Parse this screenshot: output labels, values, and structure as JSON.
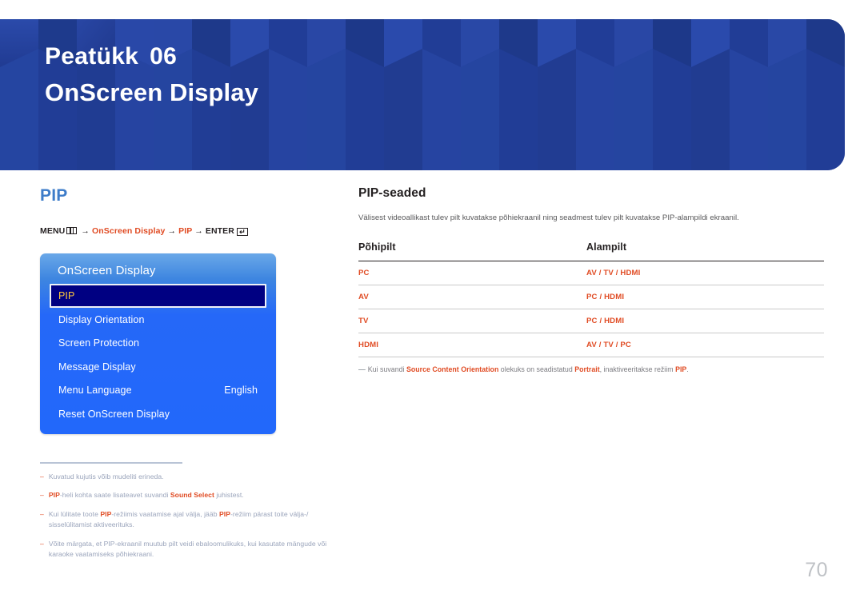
{
  "banner": {
    "chapter_label": "Peatükk",
    "chapter_number": "06",
    "chapter_title": "OnScreen Display",
    "bg_color": "#23409a"
  },
  "left": {
    "section_title": "PIP",
    "accent_color": "#e04b23",
    "menu_path": {
      "menu_label": "MENU",
      "menu_icon": "menu-grid-icon",
      "arrow1": "→",
      "step1": "OnScreen Display",
      "arrow2": "→",
      "step2": "PIP",
      "arrow3": "→",
      "enter_label": "ENTER",
      "enter_icon": "enter-key-icon",
      "enter_glyph": "↵"
    },
    "osd_panel": {
      "header": "OnScreen Display",
      "rows": [
        {
          "label": "PIP",
          "value": "",
          "selected": true
        },
        {
          "label": "Display Orientation",
          "value": "",
          "selected": false
        },
        {
          "label": "Screen Protection",
          "value": "",
          "selected": false
        },
        {
          "label": "Message Display",
          "value": "",
          "selected": false
        },
        {
          "label": "Menu Language",
          "value": "English",
          "selected": false
        },
        {
          "label": "Reset OnScreen Display",
          "value": "",
          "selected": false
        }
      ],
      "selected_bg": "#000082",
      "selected_text": "#ffc93c"
    },
    "footnotes": [
      {
        "dash": "–",
        "html": "Kuvatud kujutis võib mudeliti erineda."
      },
      {
        "dash": "–",
        "html": "<b>PIP</b>-heli kohta saate lisateavet suvandi <b>Sound Select</b> juhistest."
      },
      {
        "dash": "–",
        "html": "Kui lülitate toote <b>PIP</b>-režiimis vaatamise ajal välja, jääb <b>PIP</b>-režiim pärast toite välja-/ sisselülitamist aktiveerituks."
      },
      {
        "dash": "–",
        "html": "Võite märgata, et PIP-ekraanil muutub pilt veidi ebaloomulikuks, kui kasutate mängude või karaoke vaatamiseks põhiekraani."
      }
    ]
  },
  "right": {
    "sub_title": "PIP-seaded",
    "description": "Välisest videoallikast tulev pilt kuvatakse põhiekraanil ning seadmest tulev pilt kuvatakse PIP-alampildi ekraanil.",
    "table": {
      "headers": [
        "Põhipilt",
        "Alampilt"
      ],
      "rows": [
        [
          "PC",
          "AV / TV / HDMI"
        ],
        [
          "AV",
          "PC / HDMI"
        ],
        [
          "TV",
          "PC / HDMI"
        ],
        [
          "HDMI",
          "AV / TV / PC"
        ]
      ]
    },
    "note": {
      "dash": "―",
      "html": "Kui suvandi <b>Source Content Orientation</b> olekuks on seadistatud <b>Portrait</b>, inaktiveeritakse režiim <b>PIP</b>."
    }
  },
  "page_number": "70"
}
